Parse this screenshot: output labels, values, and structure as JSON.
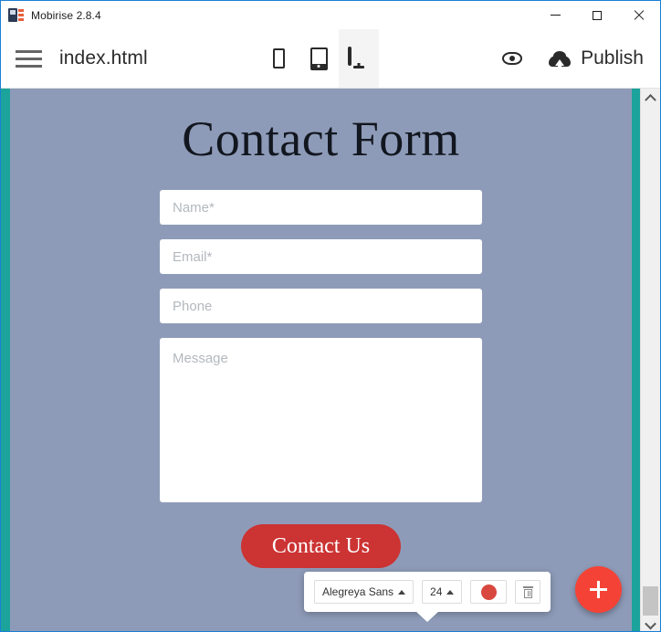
{
  "window": {
    "title": "Mobirise 2.8.4",
    "app_icon": "mobirise-logo-icon",
    "controls": {
      "minimize": "minimize-icon",
      "maximize": "maximize-icon",
      "close": "close-icon"
    }
  },
  "toolbar": {
    "menu_icon": "hamburger-menu-icon",
    "page_name": "index.html",
    "devices": [
      {
        "name": "mobile",
        "icon": "phone-icon",
        "active": false
      },
      {
        "name": "tablet",
        "icon": "tablet-icon",
        "active": false
      },
      {
        "name": "desktop",
        "icon": "desktop-icon",
        "active": true
      }
    ],
    "preview_icon": "eye-icon",
    "publish_icon": "cloud-upload-icon",
    "publish_label": "Publish"
  },
  "canvas": {
    "background_color": "#8e9bb8",
    "accent_color": "#1ba39c",
    "section": {
      "title": "Contact Form",
      "fields": [
        {
          "name": "name",
          "placeholder": "Name*",
          "value": "",
          "type": "text"
        },
        {
          "name": "email",
          "placeholder": "Email*",
          "value": "",
          "type": "text"
        },
        {
          "name": "phone",
          "placeholder": "Phone",
          "value": "",
          "type": "text"
        },
        {
          "name": "message",
          "placeholder": "Message",
          "value": "",
          "type": "textarea"
        }
      ],
      "cta_label": "Contact Us",
      "cta_color": "#cc3333"
    }
  },
  "inline_toolbar": {
    "font_family": "Alegreya Sans",
    "font_size": "24",
    "color_swatch": "#d8483f",
    "color_icon": "color-circle-icon",
    "delete_icon": "trash-icon",
    "caret_icon": "caret-up-icon"
  },
  "fab": {
    "icon": "plus-icon",
    "color": "#f44336"
  },
  "scrollbar": {
    "up_icon": "chevron-up-icon",
    "down_icon": "chevron-down-icon"
  }
}
